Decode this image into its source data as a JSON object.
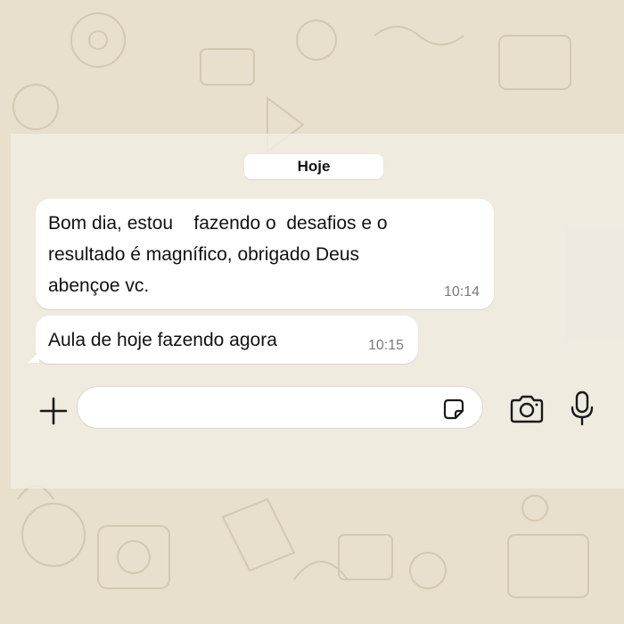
{
  "chat": {
    "date_label": "Hoje",
    "messages": [
      {
        "text": "Bom dia, estou    fazendo o  desafios e o\nresultado é magnífico, obrigado Deus\nabençoe vc.",
        "time": "10:14"
      },
      {
        "text": "Aula de hoje fazendo agora",
        "time": "10:15"
      }
    ]
  },
  "composer": {
    "placeholder": "",
    "icons": [
      "plus-icon",
      "sticker-icon",
      "camera-icon",
      "microphone-icon"
    ]
  },
  "colors": {
    "wallpaper": "#e8dfcc",
    "doodle": "#d6cab3",
    "bubble": "#ffffff",
    "timestamp": "#7b7b7b"
  }
}
